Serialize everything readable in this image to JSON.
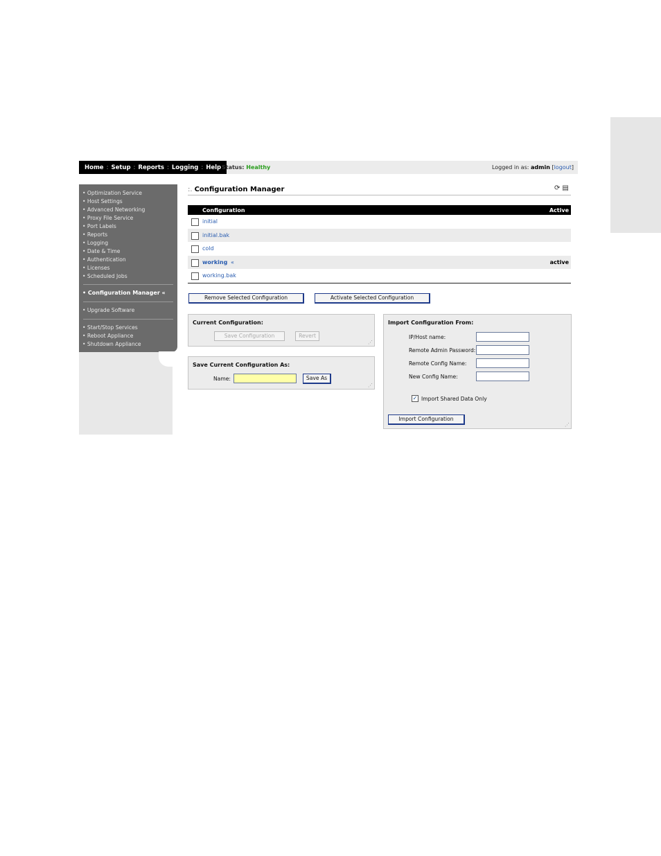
{
  "nav": {
    "items": [
      "Home",
      "Setup",
      "Reports",
      "Logging",
      "Help"
    ],
    "separator": ":"
  },
  "status": {
    "label": "Status:",
    "value": "Healthy",
    "value_color": "#2a9d1e"
  },
  "login": {
    "prefix": "Logged in as:",
    "user": "admin",
    "open": "[",
    "logout": "logout",
    "close": "]"
  },
  "sidebar": {
    "group1": [
      "Optimization Service",
      "Host Settings",
      "Advanced Networking",
      "Proxy File Service",
      "Port Labels",
      "Reports",
      "Logging",
      "Date & Time",
      "Authentication",
      "Licenses",
      "Scheduled Jobs"
    ],
    "active": "Configuration Manager «",
    "group2": [
      "Upgrade Software"
    ],
    "group3": [
      "Start/Stop Services",
      "Reboot Appliance",
      "Shutdown Appliance"
    ],
    "bullet": "•"
  },
  "page": {
    "title_prefix": ":.",
    "title": "Configuration Manager",
    "icons": [
      "refresh-icon",
      "print-icon"
    ]
  },
  "table": {
    "headers": {
      "configuration": "Configuration",
      "active": "Active"
    },
    "rows": [
      {
        "name": "initial",
        "active": ""
      },
      {
        "name": "initial.bak",
        "active": ""
      },
      {
        "name": "cold",
        "active": ""
      },
      {
        "name": "working",
        "mark": "«",
        "active": "active"
      },
      {
        "name": "working.bak",
        "active": ""
      }
    ]
  },
  "actions": {
    "remove": "Remove Selected Configuration",
    "activate": "Activate Selected Configuration"
  },
  "current_config": {
    "title": "Current Configuration:",
    "save": "Save Configuration",
    "revert": "Revert"
  },
  "save_as": {
    "title": "Save Current Configuration As:",
    "name_label": "Name:",
    "name_value": "",
    "button": "Save As"
  },
  "import": {
    "title": "Import Configuration From:",
    "fields": [
      {
        "label": "IP/Host name:",
        "value": ""
      },
      {
        "label": "Remote Admin Password:",
        "value": ""
      },
      {
        "label": "Remote Config Name:",
        "value": ""
      },
      {
        "label": "New Config Name:",
        "value": ""
      }
    ],
    "shared_label": "Import Shared Data Only",
    "shared_checked": true,
    "button": "Import Configuration"
  },
  "colors": {
    "link": "#2a5db0",
    "sidebar": "#6b6b6b",
    "button_border": "#1e3a8a",
    "input_highlight": "#ffffa8"
  }
}
